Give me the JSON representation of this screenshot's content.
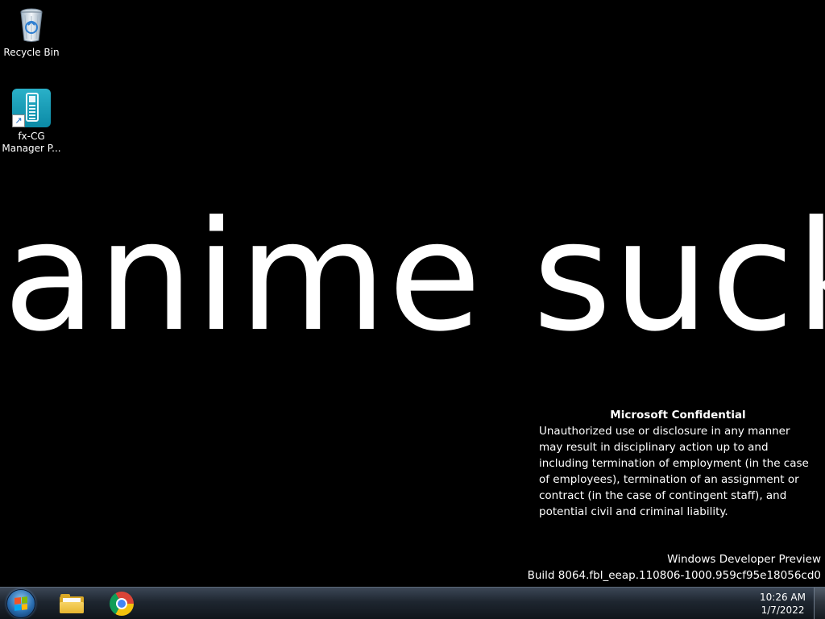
{
  "desktop": {
    "wallpaper_text": "anime sucks",
    "background_color": "#000000",
    "icons": [
      {
        "label": "Recycle Bin",
        "icon": "recycle-bin-icon"
      },
      {
        "label": "fx-CG Manager P...",
        "icon": "fx-cg-manager-icon",
        "is_shortcut": true
      }
    ],
    "watermark": {
      "title": "Microsoft Confidential",
      "body": "Unauthorized use or disclosure in any manner may result in disciplinary action up to and including termination of employment (in the case of employees), termination of an assignment or contract (in the case of contingent staff), and potential civil and criminal liability.",
      "edition": "Windows Developer Preview",
      "build": "Build 8064.fbl_eeap.110806-1000.959cf95e18056cd0"
    }
  },
  "taskbar": {
    "start_button": "start-orb-icon",
    "pinned_apps": [
      {
        "name": "Windows Explorer",
        "icon": "folder-icon"
      },
      {
        "name": "Google Chrome",
        "icon": "chrome-icon"
      }
    ],
    "clock": {
      "time": "10:26 AM",
      "date": "1/7/2022"
    }
  }
}
